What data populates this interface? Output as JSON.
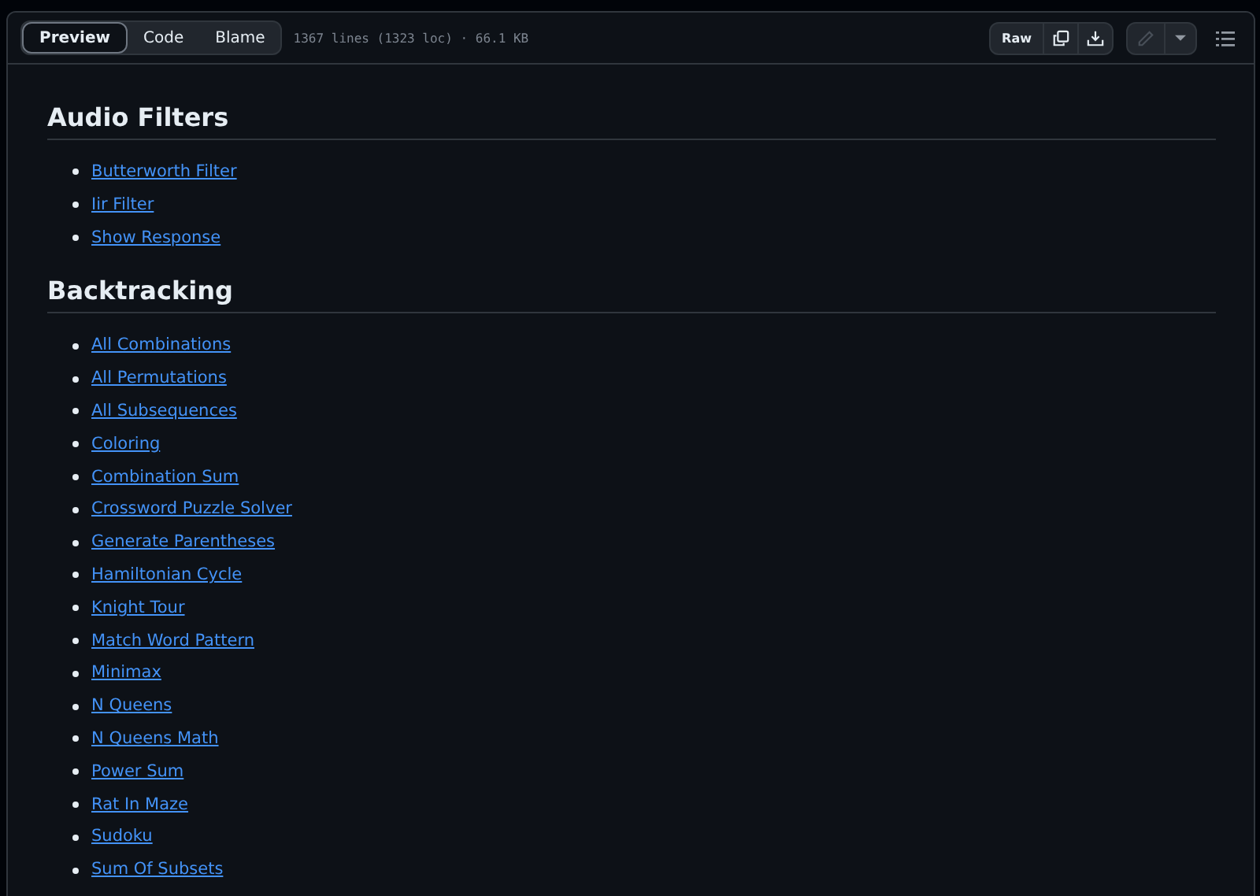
{
  "view_tabs": [
    {
      "label": "Preview",
      "selected": true
    },
    {
      "label": "Code",
      "selected": false
    },
    {
      "label": "Blame",
      "selected": false
    }
  ],
  "file_info": "1367 lines (1323 loc) · 66.1 KB",
  "raw_button": "Raw",
  "edit_button": {
    "disabled": true
  },
  "sections": [
    {
      "heading": "Audio Filters",
      "links": [
        "Butterworth Filter",
        "Iir Filter",
        "Show Response"
      ]
    },
    {
      "heading": "Backtracking",
      "links": [
        "All Combinations",
        "All Permutations",
        "All Subsequences",
        "Coloring",
        "Combination Sum",
        "Crossword Puzzle Solver",
        "Generate Parentheses",
        "Hamiltonian Cycle",
        "Knight Tour",
        "Match Word Pattern",
        "Minimax",
        "N Queens",
        "N Queens Math",
        "Power Sum",
        "Rat In Maze",
        "Sudoku",
        "Sum Of Subsets"
      ]
    }
  ]
}
